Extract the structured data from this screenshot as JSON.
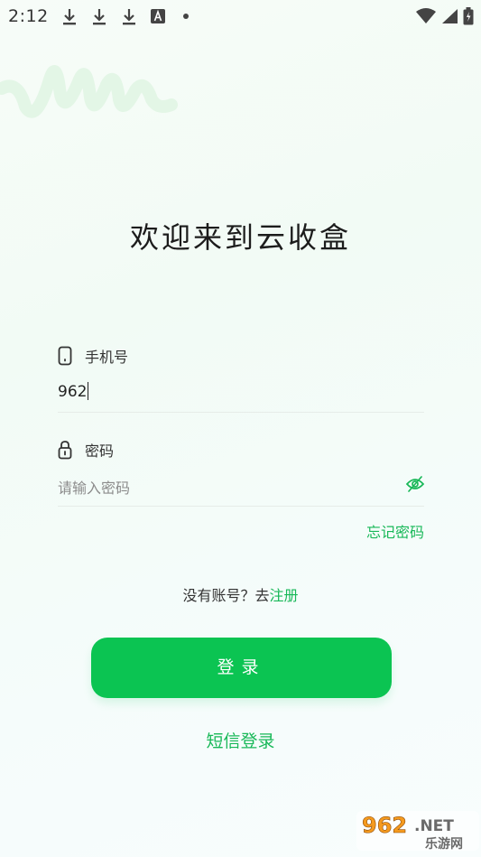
{
  "status_bar": {
    "time": "2:12",
    "notification_icons": [
      "download-icon",
      "download-icon",
      "download-icon",
      "font-app-icon",
      "dot-icon"
    ],
    "system_icons": [
      "wifi-icon",
      "cell-signal-icon",
      "battery-icon"
    ]
  },
  "welcome_title": "欢迎来到云收盒",
  "phone_field": {
    "label": "手机号",
    "value": "962",
    "icon": "phone-icon"
  },
  "password_field": {
    "label": "密码",
    "placeholder": "请输入密码",
    "icon": "lock-icon",
    "toggle_icon": "eye-off-icon"
  },
  "forgot_password": "忘记密码",
  "register": {
    "prompt": "没有账号？去",
    "link": "注册"
  },
  "login_button": "登录",
  "sms_login": "短信登录",
  "watermark": {
    "line1": "962.NET",
    "line2": "乐游网"
  },
  "colors": {
    "accent": "#0bc452",
    "link": "#18b858",
    "background": "#f5fcf8"
  }
}
